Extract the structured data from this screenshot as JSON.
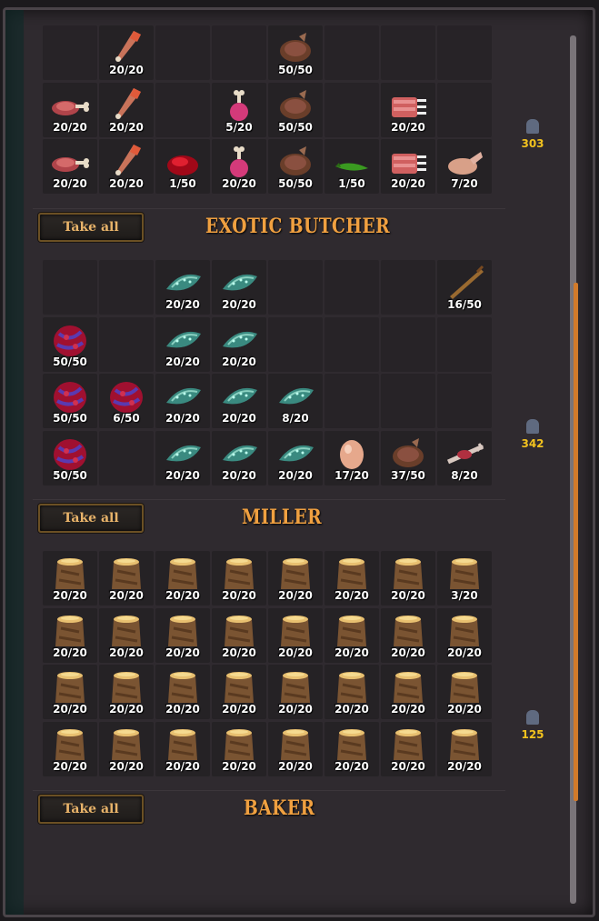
{
  "sections": [
    {
      "title": "",
      "button": "",
      "weight": "303",
      "slots": [
        "",
        "drumstick",
        "",
        "",
        "neck",
        "",
        "",
        "",
        "meat",
        "drumstick",
        "",
        "pink",
        "neck",
        "",
        "ribs",
        "",
        "meat",
        "drumstick",
        "redblob",
        "pink",
        "neck",
        "pepper",
        "ribs",
        "chicken"
      ],
      "qty": [
        "",
        "20/20",
        "",
        "",
        "50/50",
        "",
        "",
        "",
        "20/20",
        "20/20",
        "",
        "5/20",
        "50/50",
        "",
        "20/20",
        "",
        "20/20",
        "20/20",
        "1/50",
        "20/20",
        "50/50",
        "1/50",
        "20/20",
        "7/20"
      ]
    },
    {
      "title": "EXOTIC BUTCHER",
      "button": "Take all",
      "weight": "342",
      "slots": [
        "",
        "",
        "fish",
        "fish",
        "",
        "",
        "",
        "stick",
        "organ",
        "",
        "fish",
        "fish",
        "",
        "",
        "",
        "",
        "organ",
        "organ",
        "fish",
        "fish",
        "fish",
        "",
        "",
        "",
        "organ",
        "",
        "fish",
        "fish",
        "fish",
        "egg",
        "neck",
        "bone"
      ],
      "qty": [
        "",
        "",
        "20/20",
        "20/20",
        "",
        "",
        "",
        "16/50",
        "50/50",
        "",
        "20/20",
        "20/20",
        "",
        "",
        "",
        "",
        "50/50",
        "6/50",
        "20/20",
        "20/20",
        "8/20",
        "",
        "",
        "",
        "50/50",
        "",
        "20/20",
        "20/20",
        "20/20",
        "17/20",
        "37/50",
        "8/20"
      ]
    },
    {
      "title": "MILLER",
      "button": "Take all",
      "weight": "125",
      "slots": [
        "sack",
        "sack",
        "sack",
        "sack",
        "sack",
        "sack",
        "sack",
        "sack",
        "sack",
        "sack",
        "sack",
        "sack",
        "sack",
        "sack",
        "sack",
        "sack",
        "sack",
        "sack",
        "sack",
        "sack",
        "sack",
        "sack",
        "sack",
        "sack",
        "sack",
        "sack",
        "sack",
        "sack",
        "sack",
        "sack",
        "sack",
        "sack"
      ],
      "qty": [
        "20/20",
        "20/20",
        "20/20",
        "20/20",
        "20/20",
        "20/20",
        "20/20",
        "3/20",
        "20/20",
        "20/20",
        "20/20",
        "20/20",
        "20/20",
        "20/20",
        "20/20",
        "20/20",
        "20/20",
        "20/20",
        "20/20",
        "20/20",
        "20/20",
        "20/20",
        "20/20",
        "20/20",
        "20/20",
        "20/20",
        "20/20",
        "20/20",
        "20/20",
        "20/20",
        "20/20",
        "20/20"
      ]
    },
    {
      "title": "BAKER",
      "button": "Take all",
      "weight": "",
      "slots": [],
      "qty": []
    }
  ]
}
